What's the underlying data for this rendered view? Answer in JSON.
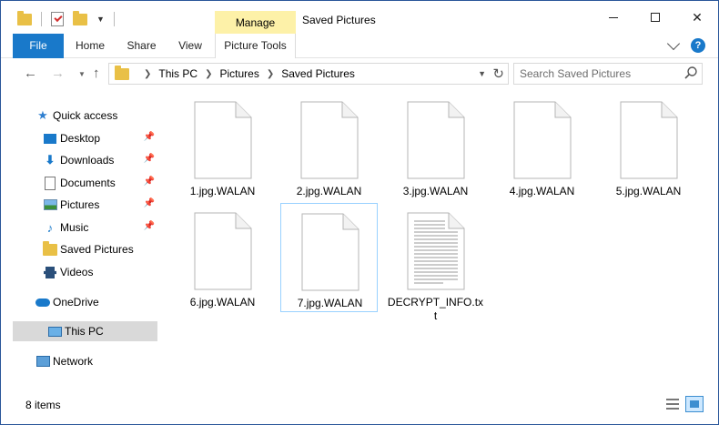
{
  "window": {
    "title": "Saved Pictures",
    "manage_label": "Manage",
    "close_glyph": "✕"
  },
  "ribbon": {
    "tabs": [
      {
        "label": "File"
      },
      {
        "label": "Home"
      },
      {
        "label": "Share"
      },
      {
        "label": "View"
      },
      {
        "label": "Picture Tools"
      }
    ],
    "help_glyph": "?"
  },
  "address": {
    "crumbs": [
      "This PC",
      "Pictures",
      "Saved Pictures"
    ],
    "search_placeholder": "Search Saved Pictures"
  },
  "sidebar": {
    "items": [
      {
        "label": "Quick access",
        "icon": "star-icon"
      },
      {
        "label": "Desktop",
        "icon": "desktop-icon",
        "pinned": true
      },
      {
        "label": "Downloads",
        "icon": "download-icon",
        "pinned": true
      },
      {
        "label": "Documents",
        "icon": "documents-icon",
        "pinned": true
      },
      {
        "label": "Pictures",
        "icon": "pictures-icon",
        "pinned": true
      },
      {
        "label": "Music",
        "icon": "music-icon",
        "pinned": true
      },
      {
        "label": "Saved Pictures",
        "icon": "folder-icon"
      },
      {
        "label": "Videos",
        "icon": "videos-icon"
      },
      {
        "label": "OneDrive",
        "icon": "onedrive-icon"
      },
      {
        "label": "This PC",
        "icon": "this-pc-icon",
        "selected": true
      },
      {
        "label": "Network",
        "icon": "network-icon"
      }
    ]
  },
  "files": [
    {
      "name": "1.jpg.WALAN",
      "type": "blank"
    },
    {
      "name": "2.jpg.WALAN",
      "type": "blank"
    },
    {
      "name": "3.jpg.WALAN",
      "type": "blank"
    },
    {
      "name": "4.jpg.WALAN",
      "type": "blank"
    },
    {
      "name": "5.jpg.WALAN",
      "type": "blank"
    },
    {
      "name": "6.jpg.WALAN",
      "type": "blank"
    },
    {
      "name": "7.jpg.WALAN",
      "type": "blank",
      "selected": true
    },
    {
      "name": "DECRYPT_INFO.txt",
      "type": "text"
    }
  ],
  "status": {
    "item_count": "8 items"
  },
  "colors": {
    "accent": "#1979ca",
    "manage_tab": "#fdf1a8",
    "selection": "#d9d9d9"
  }
}
